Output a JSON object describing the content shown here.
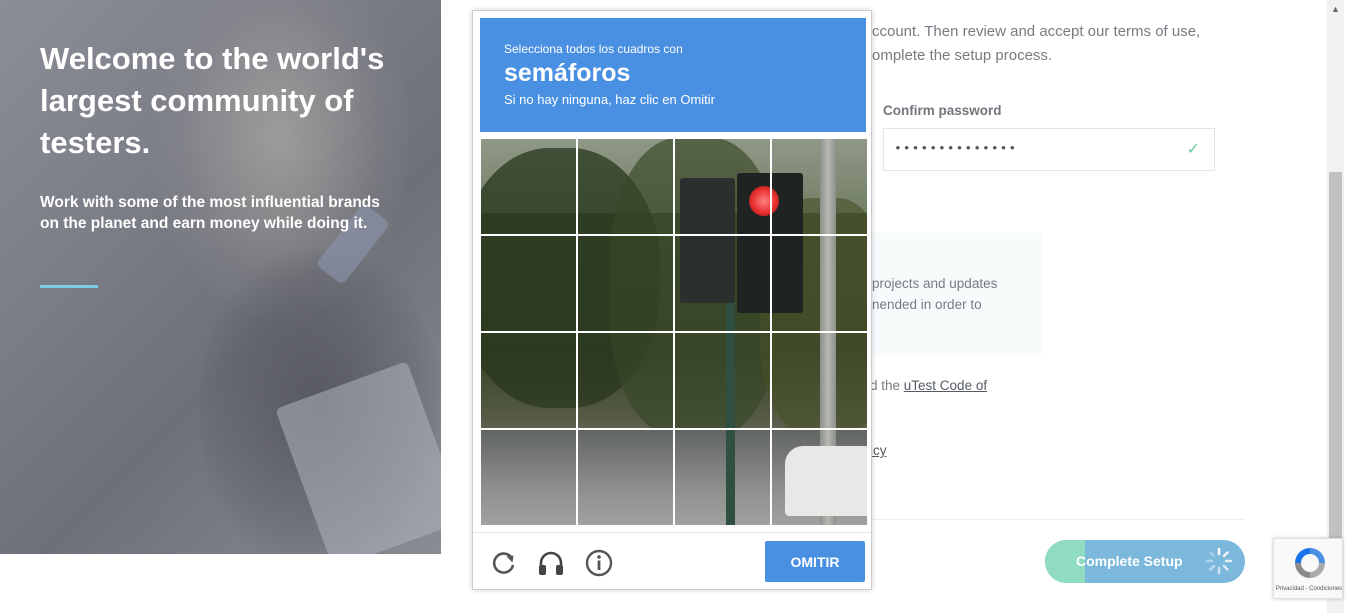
{
  "hero": {
    "title": "Welcome to the world's largest community of testers.",
    "subtitle": "Work with some of the most influential brands on the planet and earn money while doing it."
  },
  "form": {
    "intro": "ccount. Then review and accept our terms of use, omplete the setup process.",
    "confirm_password_label": "Confirm password",
    "confirm_password_value": "••••••••••••••",
    "notice_text": "projects and updates nended in order to",
    "terms_prefix": "d the ",
    "terms_link": "uTest Code of",
    "privacy_link": "icy",
    "complete_button": "Complete Setup"
  },
  "captcha": {
    "instruction_line": "Selecciona todos los cuadros con",
    "target_object": "semáforos",
    "hint": "Si no hay ninguna, haz clic en Omitir",
    "skip_button": "OMITIR",
    "icons": [
      "reload-icon",
      "audio-icon",
      "info-icon"
    ]
  },
  "badge": {
    "text": "Privacidad - Condiciones"
  },
  "colors": {
    "captcha_blue": "#4a90e2",
    "button_blue": "#7bb8dc",
    "button_green": "#8fdcc0",
    "accent_rule": "#7fcbe6"
  }
}
